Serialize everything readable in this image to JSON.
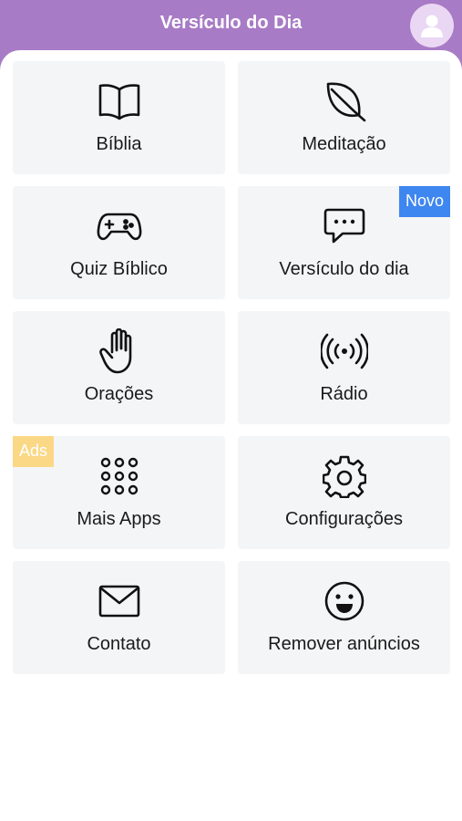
{
  "header": {
    "title": "Versículo do Dia",
    "avatar_icon": "user-icon"
  },
  "tiles": [
    {
      "label": "Bíblia",
      "icon": "book-icon"
    },
    {
      "label": "Meditação",
      "icon": "leaf-icon"
    },
    {
      "label": "Quiz Bíblico",
      "icon": "gamepad-icon"
    },
    {
      "label": "Versículo do dia",
      "icon": "chat-bubble-icon",
      "badge": "Novo"
    },
    {
      "label": "Orações",
      "icon": "hand-icon"
    },
    {
      "label": "Rádio",
      "icon": "radio-broadcast-icon"
    },
    {
      "label": "Mais Apps",
      "icon": "grid-dots-icon",
      "badge": "Ads"
    },
    {
      "label": "Configurações",
      "icon": "gear-icon"
    },
    {
      "label": "Contato",
      "icon": "envelope-icon"
    },
    {
      "label": "Remover anúncios",
      "icon": "smiley-icon"
    }
  ],
  "colors": {
    "header": "#a87bc6",
    "tile": "#f4f5f7",
    "badge_novo": "#3e86f0",
    "badge_ads": "#fbd886"
  }
}
